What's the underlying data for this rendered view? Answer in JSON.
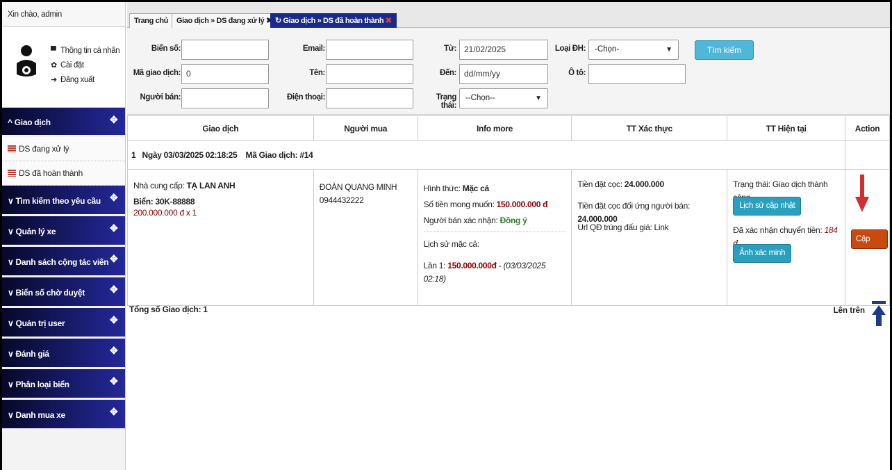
{
  "sidebar": {
    "greeting": "Xin chào, admin",
    "profile_menu": [
      {
        "icon": "comment-icon",
        "label": "Thông tin cá nhân"
      },
      {
        "icon": "gear-icon",
        "label": "Cài đặt"
      },
      {
        "icon": "sign-out-icon",
        "label": "Đăng xuất"
      }
    ],
    "nav": [
      {
        "label": "Giao dịch",
        "expanded": true
      },
      {
        "label": "Tìm kiếm theo yêu cầu"
      },
      {
        "label": "Quản lý xe"
      },
      {
        "label": "Danh sách cộng tác viên"
      },
      {
        "label": "Biển số chờ duyệt"
      },
      {
        "label": "Quản trị user"
      },
      {
        "label": "Đánh giá"
      },
      {
        "label": "Phân loại biển"
      },
      {
        "label": "Danh mua xe"
      }
    ],
    "sub_items": [
      "DS đang xử lý",
      "DS đã hoàn thành"
    ]
  },
  "tabs": {
    "home": "Trang chủ",
    "tab1": "Giao dịch » DS đang xử lý",
    "tab2": "Giao dịch » DS đã hoàn thành",
    "close": "✖"
  },
  "search": {
    "plate_label": "Biển số:",
    "plate_value": "",
    "txid_label": "Mã giao dịch:",
    "txid_value": "0",
    "seller_label": "Người bán:",
    "seller_value": "",
    "email_label": "Email:",
    "email_value": "",
    "name_label": "Tên:",
    "name_value": "",
    "phone_label": "Điện thoại:",
    "phone_value": "",
    "from_label": "Từ:",
    "from_value": "21/02/2025",
    "to_label": "Đến:",
    "to_value": "dd/mm/yy",
    "status_label": "Trạng thái:",
    "status_value": "--Chọn--",
    "type_label": "Loại ĐH:",
    "type_value": "-Chọn-",
    "car_label": "Ô tô:",
    "car_value": "",
    "button": "Tìm kiếm"
  },
  "table": {
    "headers": [
      "Giao dịch",
      "Người mua",
      "Info more",
      "TT Xác thực",
      "TT Hiện tại",
      "Action"
    ],
    "row_index": "1",
    "row_date": "Ngày 03/03/2025 02:18:25",
    "row_code": "Mã Giao dịch: #14",
    "col1": {
      "supplier_label": "Nhà cung cấp: ",
      "supplier": "TẠ LAN ANH",
      "plate": "Biển: 30K-88888",
      "price": "200.000.000 đ x 1"
    },
    "col2": {
      "buyer": "ĐOÀN QUANG MINH",
      "phone": "0944432222"
    },
    "col3": {
      "method_label": "Hình thức: ",
      "method": "Mặc cả",
      "wanted_label": "Số tiền mong muốn: ",
      "wanted": "150.000.000 đ",
      "confirm_label": "Người bán xác nhận: ",
      "confirm": "Đồng ý",
      "history_label": "Lịch sử mặc cả:",
      "round_label": "Lần 1: ",
      "round_value": "150.000.000đ",
      "round_sep": " - ",
      "round_time": "(03/03/2025 02:18)"
    },
    "col4": {
      "deposit_label": "Tiền đặt cọc: ",
      "deposit": "24.000.000",
      "counter_label": "Tiền đặt cọc đối ứng người bán: ",
      "counter": "24.000.000",
      "url_label": "Url QĐ trúng đấu giá: ",
      "url": "Link"
    },
    "col5": {
      "status": "Trạng thái: Giao dịch thành công",
      "history_btn": "Lịch sử cập nhật",
      "transfer_label": "Đã xác nhận chuyển tiền: ",
      "transfer": "184 đ",
      "image_btn": "Ảnh xác minh"
    },
    "action_btn": "Cập nhật"
  },
  "footer": {
    "total_label": "Tổng số Giao dịch: ",
    "total": "1",
    "to_top": "Lên trên"
  },
  "colors": {
    "nav_dark": "#07082a",
    "nav_light": "#24289a",
    "accent_teal": "#2aa0bf",
    "update_btn": "#c84a0e",
    "arrow": "#d32f2f"
  }
}
